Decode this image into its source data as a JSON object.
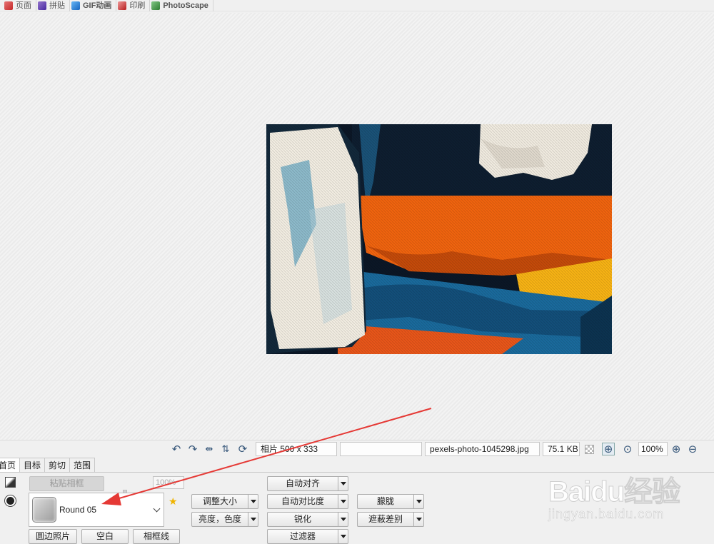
{
  "top_tabs": [
    {
      "label": "页面",
      "icon": "page-mode-icon",
      "color": "#d9534f"
    },
    {
      "label": "拼贴",
      "icon": "combine-icon",
      "color": "#6a5acd"
    },
    {
      "label": "GIF动画",
      "icon": "gif-icon",
      "color": "#3a7bd5"
    },
    {
      "label": "印刷",
      "icon": "print-icon",
      "color": "#d9534f"
    },
    {
      "label": "PhotoScape",
      "icon": "photoscape-icon",
      "color": "#4caf50"
    }
  ],
  "status": {
    "photo_info": "相片 500 x 333",
    "empty_field": "",
    "filename": "pexels-photo-1045298.jpg",
    "filesize": "75.1 KB",
    "zoom": "100%"
  },
  "edit_tabs": [
    "首页",
    "目标",
    "剪切",
    "范围"
  ],
  "home_panel": {
    "paste_frame_label": "粘贴相框",
    "frame_percent": "100%",
    "frame_name": "Round 05",
    "bottom_buttons": [
      "圆边照片",
      "空白",
      "相框线"
    ],
    "resize_label": "调整大小",
    "brightness_label": "亮度，色度",
    "auto_level_label": "自动对齐",
    "auto_contrast_label": "自动对比度",
    "sharpen_label": "锐化",
    "filter_label": "过滤器",
    "bloom_label": "朦胧",
    "backlight_label": "遮蔽差别"
  },
  "watermark": {
    "brand": "Baidu经验",
    "url": "jingyan.baidu.com"
  },
  "colors": {
    "annotation_arrow": "#e53935",
    "accent_icon": "#37577a"
  }
}
